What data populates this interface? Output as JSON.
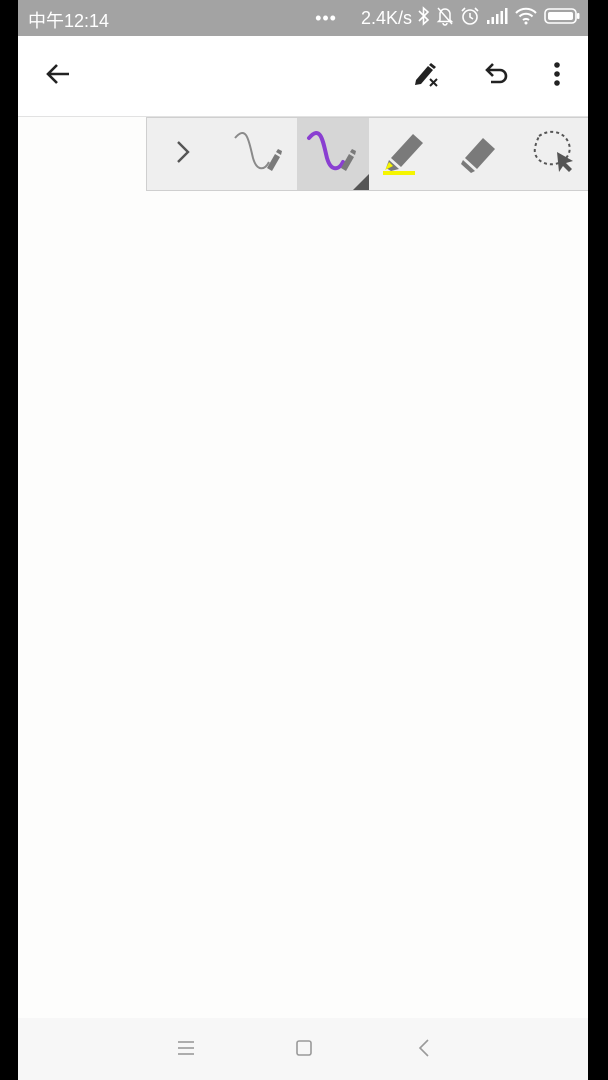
{
  "status_bar": {
    "time": "中午12:14",
    "dots": "•••",
    "network_speed": "2.4K/s",
    "icons": [
      "bluetooth-icon",
      "alarm-muted-icon",
      "alarm-clock-icon",
      "signal-icon",
      "wifi-icon",
      "battery-icon"
    ]
  },
  "app_bar": {
    "icons": [
      "back-arrow-icon",
      "pen-clear-icon",
      "undo-icon",
      "more-vert-icon"
    ]
  },
  "toolbar": {
    "tools": [
      {
        "name": "collapse",
        "icon": "chevron-right-icon"
      },
      {
        "name": "pen",
        "icon": "pen-stroke-icon"
      },
      {
        "name": "pen-purple",
        "icon": "pen-stroke-purple-icon",
        "selected": true
      },
      {
        "name": "highlighter",
        "icon": "highlighter-icon"
      },
      {
        "name": "eraser",
        "icon": "eraser-icon"
      },
      {
        "name": "lasso",
        "icon": "lasso-select-icon"
      }
    ],
    "colors": {
      "pen": "#8a8a8a",
      "pen_selected": "#8a3fd1",
      "highlighter": "#f5f500",
      "icon_gray": "#7a7a7a"
    }
  },
  "nav_bar": {
    "icons": [
      "menu-icon",
      "home-square-icon",
      "back-chevron-icon"
    ]
  }
}
